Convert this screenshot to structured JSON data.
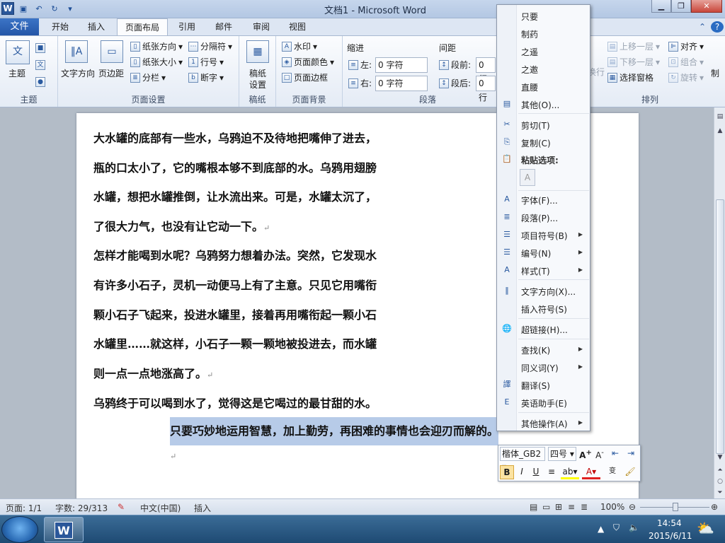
{
  "app": {
    "title": "文档1 - Microsoft Word"
  },
  "tabs": [
    "文件",
    "开始",
    "插入",
    "页面布局",
    "引用",
    "邮件",
    "审阅",
    "视图"
  ],
  "ribbon": {
    "theme": {
      "label": "主题",
      "button": "主题"
    },
    "page_setup": {
      "label": "页面设置",
      "text_direction": "文字方向",
      "margins": "页边距",
      "orientation": "纸张方向",
      "size": "纸张大小",
      "columns": "分栏",
      "breaks": "分隔符",
      "line_numbers": "行号",
      "hyphenation": "断字"
    },
    "manuscript": {
      "label": "稿纸",
      "button_line1": "稿纸",
      "button_line2": "设置"
    },
    "page_background": {
      "label": "页面背景",
      "watermark": "水印",
      "page_color": "页面颜色",
      "page_borders": "页面边框"
    },
    "paragraph": {
      "label": "段落",
      "indent_title": "缩进",
      "spacing_title": "间距",
      "left_label": "左:",
      "right_label": "右:",
      "before_label": "段前:",
      "after_label": "段后:",
      "left_value": "0 字符",
      "right_value": "0 字符",
      "before_value": "0 行",
      "after_value": "0 行"
    },
    "arrange": {
      "label": "排列",
      "wrap": "换行",
      "bring_forward": "上移一层",
      "send_backward": "下移一层",
      "selection_pane": "选择窗格",
      "align": "对齐",
      "group": "组合",
      "rotate": "旋转",
      "partial": "制"
    }
  },
  "document": {
    "lines": [
      "大水罐的底部有一些水，乌鸦迫不及待地把嘴伸了进去，",
      "瓶的口太小了，它的嘴根本够不到底部的水。乌鸦用翅膀",
      "水罐，想把水罐推倒，让水流出来。可是，水罐太沉了，",
      "了很大力气，也没有让它动一下。",
      "怎样才能喝到水呢？乌鸦努力想着办法。突然，它发现水",
      "有许多小石子，灵机一动便马上有了主意。只见它用嘴衔",
      "颗小石子飞起来，投进水罐里，接着再用嘴衔起一颗小石",
      "水罐里……就这样，小石子一颗一颗地被投进去，而水罐",
      "则一点一点地涨高了。",
      "乌鸦终于可以喝到水了，觉得这是它喝过的最甘甜的水。",
      "只要巧妙地运用智慧，加上勤劳，再困难的事情也会迎刃而解的。"
    ]
  },
  "context_menu": {
    "chinese_candidates": [
      "只要",
      "制药",
      "之遥",
      "之邀",
      "直腰"
    ],
    "other": "其他(O)...",
    "cut": "剪切(T)",
    "copy": "复制(C)",
    "paste_options": "粘贴选项:",
    "font": "字体(F)...",
    "paragraph": "段落(P)...",
    "bullets": "项目符号(B)",
    "numbering": "编号(N)",
    "styles": "样式(T)",
    "text_direction": "文字方向(X)...",
    "insert_symbol": "插入符号(S)",
    "hyperlink": "超链接(H)...",
    "lookup": "查找(K)",
    "synonyms": "同义词(Y)",
    "translate": "翻译(S)",
    "english_assistant": "英语助手(E)",
    "other_actions": "其他操作(A)"
  },
  "mini_toolbar": {
    "font": "楷体_GB2",
    "size": "四号"
  },
  "status": {
    "page": "页面: 1/1",
    "words": "字数: 29/313",
    "language": "中文(中国)",
    "insert": "插入",
    "zoom": "100%"
  },
  "taskbar": {
    "time": "14:54",
    "date": "2015/6/11"
  }
}
